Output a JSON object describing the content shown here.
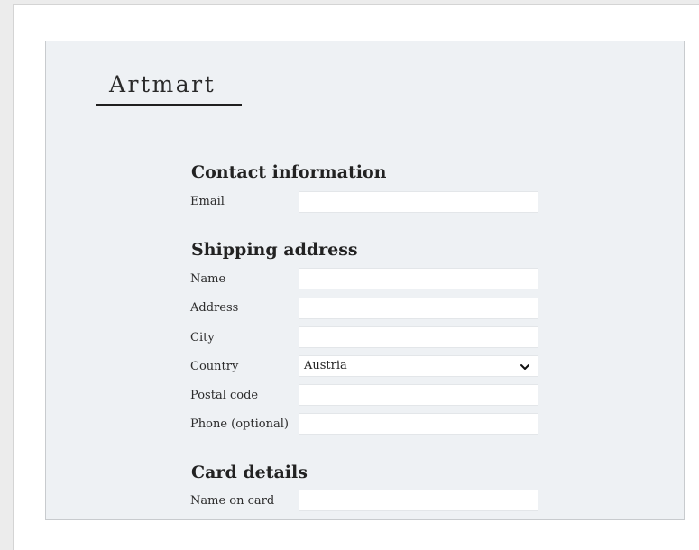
{
  "brand": {
    "name": "Artmart"
  },
  "contact": {
    "title": "Contact information",
    "email_label": "Email",
    "email_value": ""
  },
  "shipping": {
    "title": "Shipping address",
    "name_label": "Name",
    "name_value": "",
    "address_label": "Address",
    "address_value": "",
    "city_label": "City",
    "city_value": "",
    "country_label": "Country",
    "country_value": "Austria",
    "postal_label": "Postal code",
    "postal_value": "",
    "phone_label": "Phone (optional)",
    "phone_value": ""
  },
  "card": {
    "title": "Card details",
    "name_on_card_label": "Name on card",
    "name_on_card_value": ""
  },
  "icons": {
    "country_dropdown": "chevron-down-icon"
  }
}
